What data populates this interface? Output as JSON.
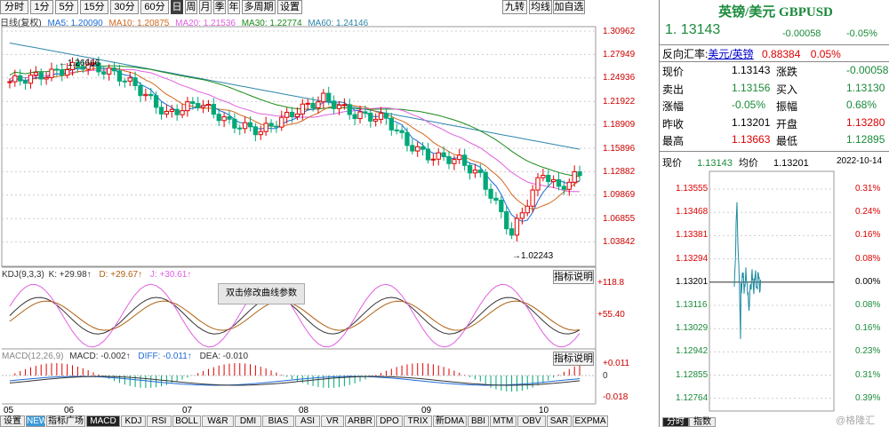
{
  "toolbar": {
    "periods": [
      "分时",
      "1分",
      "5分",
      "15分",
      "30分",
      "60分",
      "日",
      "周",
      "月",
      "季",
      "年",
      "多周期",
      "设置"
    ],
    "active": "日",
    "right_buttons": [
      "九转",
      "均线",
      "加自选"
    ]
  },
  "ma_legend": {
    "title": "日线(复权)",
    "ma5": "MA5: 1.20090",
    "ma10": "MA10: 1.20875",
    "ma20": "MA20: 1.21536",
    "ma30": "MA30: 1.22774",
    "ma60": "MA60: 1.24146"
  },
  "price_axis": [
    "1.30962",
    "1.27949",
    "1.24936",
    "1.21922",
    "1.18909",
    "1.15896",
    "1.12882",
    "1.09869",
    "1.06855",
    "1.03842"
  ],
  "annotations": {
    "high": "1.26666",
    "low": "1.02243"
  },
  "kdj": {
    "label": "KDJ(9,3,3)",
    "k": "K: +29.98↑",
    "d": "D: +29.67↑",
    "j": "J: +30.61↑",
    "btn": "指标说明",
    "axis_top": "+118.8",
    "axis_mid": "+55.40"
  },
  "tooltip": "双击修改曲线参数",
  "macd": {
    "label": "MACD(12,26,9)",
    "macd": "MACD: -0.002↑",
    "diff": "DIFF: -0.011↑",
    "dea": "DEA: -0.010",
    "btn": "指标说明",
    "axis_top": "+0.011",
    "axis_mid": "0",
    "axis_bot": "-0.018"
  },
  "months": [
    "05",
    "06",
    "07",
    "08",
    "09",
    "10"
  ],
  "bottom_tabs": [
    "设置",
    "NEW",
    "指标广场",
    "MACD",
    "KDJ",
    "RSI",
    "BOLL",
    "W&R",
    "DMI",
    "BIAS",
    "ASI",
    "VR",
    "ARBR",
    "DPO",
    "TRIX",
    "新DMA",
    "BBI",
    "MTM",
    "OBV",
    "SAR",
    "EXPMA"
  ],
  "bottom_active": "MACD",
  "quote": {
    "name": "英镑/美元 GBPUSD",
    "price": "1. 13143",
    "change": "-0.00058",
    "pct": "-0.05%",
    "reverse_label": "反向汇率:",
    "reverse_pair": "美元/英镑",
    "reverse_val": "0.88384",
    "reverse_pct": "0.05%",
    "rows": [
      {
        "l1": "现价",
        "v1": "1.13143",
        "l2": "涨跌",
        "v2": "-0.00058"
      },
      {
        "l1": "卖出",
        "v1": "1.13156",
        "l2": "买入",
        "v2": "1.13130"
      },
      {
        "l1": "涨幅",
        "v1": "-0.05%",
        "l2": "振幅",
        "v2": "0.68%"
      },
      {
        "l1": "昨收",
        "v1": "1.13201",
        "l2": "开盘",
        "v2": "1.13280"
      },
      {
        "l1": "最高",
        "v1": "1.13663",
        "l2": "最低",
        "v2": "1.12895"
      }
    ]
  },
  "intraday": {
    "label_now": "现价",
    "now": "1.13143",
    "label_avg": "均价",
    "avg": "1.13201",
    "date": "2022-10-14",
    "left_axis": [
      "1.13555",
      "1.13468",
      "1.13381",
      "1.13294",
      "1.13201",
      "1.13116",
      "1.13029",
      "1.12942",
      "1.12855",
      "1.12764"
    ],
    "right_axis": [
      "0.31%",
      "0.24%",
      "0.16%",
      "0.08%",
      "0.00%",
      "0.08%",
      "0.16%",
      "0.23%",
      "0.31%",
      "0.39%"
    ],
    "tabs": [
      "分时",
      "指数"
    ],
    "watermark": "@格隆汇"
  },
  "colors": {
    "up": "#e00000",
    "down": "#00a878",
    "ma5": "#1e6bd6",
    "ma10": "#d2691e",
    "ma20": "#e060e0",
    "ma30": "#1a8a1a",
    "ma60": "#2e86ab"
  },
  "chart_data": {
    "type": "candlestick",
    "note_series": [
      "MA5",
      "MA10",
      "MA20",
      "MA30",
      "MA60"
    ]
  }
}
